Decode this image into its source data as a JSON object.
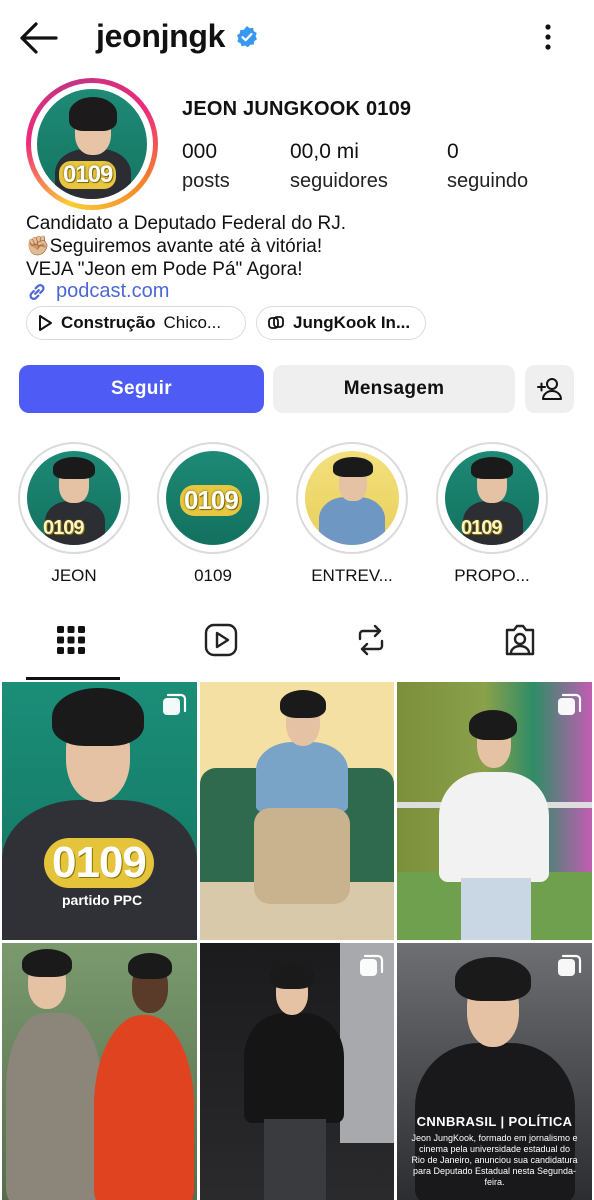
{
  "header": {
    "username": "jeonjngk",
    "back_icon": "arrow-left-icon",
    "verified_icon": "verified-badge-icon",
    "more_icon": "kebab-icon"
  },
  "profile": {
    "display_name": "JEON JUNGKOOK 0109",
    "avatar_badge": "0109",
    "stats": [
      {
        "value": "000",
        "label": "posts"
      },
      {
        "value": "00,0 mi",
        "label": "seguidores"
      },
      {
        "value": "0",
        "label": "seguindo"
      }
    ],
    "bio": [
      "Candidato a Deputado Federal do RJ.",
      "✊🏼Seguiremos avante até à vitória!",
      "VEJA \"Jeon em Pode Pá\" Agora!"
    ],
    "link": "podcast.com",
    "chips": [
      {
        "bold": "Construção",
        "rest": "Chico...",
        "icon": "play-icon"
      },
      {
        "bold": "JungKook In...",
        "rest": "",
        "icon": "threads-icon"
      }
    ]
  },
  "actions": {
    "follow": "Seguir",
    "message": "Mensagem",
    "add_user_icon": "add-user-icon"
  },
  "highlights": [
    {
      "label": "JEON",
      "badge": "0109"
    },
    {
      "label": "0109",
      "badge": "0109"
    },
    {
      "label": "ENTREV...",
      "badge": ""
    },
    {
      "label": "PROPO...",
      "badge": "0109"
    }
  ],
  "tabs": [
    "grid-icon",
    "reels-icon",
    "reposts-icon",
    "tagged-icon"
  ],
  "posts": [
    {
      "big": "0109",
      "sub": "partido PPC"
    },
    {
      "big": "",
      "sub": ""
    },
    {
      "big": "",
      "sub": ""
    },
    {
      "big": "",
      "sub": ""
    },
    {
      "big": "",
      "sub": ""
    },
    {
      "heading": "CNNBRASIL | POLÍTICA",
      "text": "Jeon JungKook, formado em jornalismo e cinema pela universidade estadual do Rio de Janeiro, anunciou sua candidatura para Deputado Estadual nesta Segunda-feira."
    }
  ],
  "colors": {
    "follow_bg": "#4f5bf5",
    "link": "#4c68d7",
    "secondary_bg": "#efefef"
  }
}
